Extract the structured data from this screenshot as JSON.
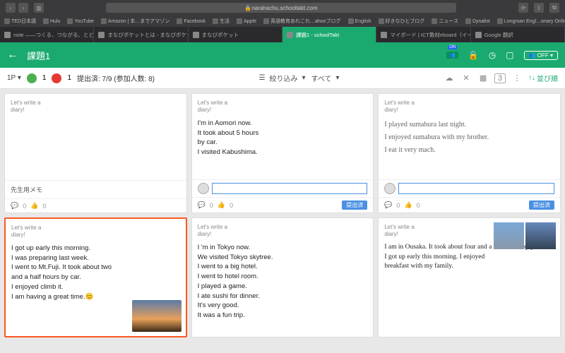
{
  "browser": {
    "url": "narahachu.schooltakt.com"
  },
  "bookmarks": [
    "TED日本語",
    "Hulu",
    "YouTube",
    "Amazon | 本…までアマゾン",
    "Facebook",
    "生活",
    "Apple",
    "英語教育あれこれ…ahooブログ",
    "English",
    "好きなひとブログ",
    "ニュース",
    "Dynalist",
    "Longman Engl…onary Online"
  ],
  "tabs": [
    {
      "label": "note ――つくる、つながる、とどける。"
    },
    {
      "label": "まなびポケットとは - まなびポケット｜…"
    },
    {
      "label": "まなびポケット"
    },
    {
      "label": "課題1 - schoolTakt",
      "active": true
    },
    {
      "label": "マイボード | ICT教材eboard（イーボ…"
    },
    {
      "label": "Google 翻訳"
    }
  ],
  "header": {
    "title": "課題1"
  },
  "toolbar": {
    "page": "1P",
    "green": "1",
    "red": "1",
    "status": "提出済: 7/9 (参加人数: 8)",
    "filter": "絞り込み",
    "all": "すべて",
    "boxnum": "3",
    "sort": "並び順"
  },
  "prompt": "Let's write a\ndiary!",
  "cards": [
    {
      "memo": "先生用メモ",
      "c": "0",
      "l": "0"
    },
    {
      "diary": "I'm  in  Aomori  now.\nIt  took  about  5 hours\nby  car.\nI  visited  Kabushima.",
      "c": "0",
      "l": "0",
      "badge": "提出済",
      "input": true
    },
    {
      "hand": "I  played   sumabura  last night.\nI  enjoyed  sumabura  with my brother.\nI  eat   it  very  mach.",
      "c": "0",
      "l": "0",
      "badge": "提出済",
      "input": true
    },
    {
      "diary": "I got up early this morning.\nI was preparing last week.\nI went to Mt.Fuji. It took about two\nand a half hours by car.\nI enjoyed climb it.\nI am having a great time.😊",
      "selected": true,
      "img": "sunset"
    },
    {
      "diary": " I 'm in Tokyo  now.\nWe visited Tokyo skytree.\nI went to a big hotel.\nI went to hotel room.\nI played a game.\n I  ate sushi for dinner.\nIt's very good.\nIt was a fun trip."
    },
    {
      "diary": "I am in Ousaka.  It took about four and a half hours by plane.\nI got up early this morning. I enjoyed\nbreakfast with my family.",
      "img": "castle",
      "serif": true
    }
  ]
}
